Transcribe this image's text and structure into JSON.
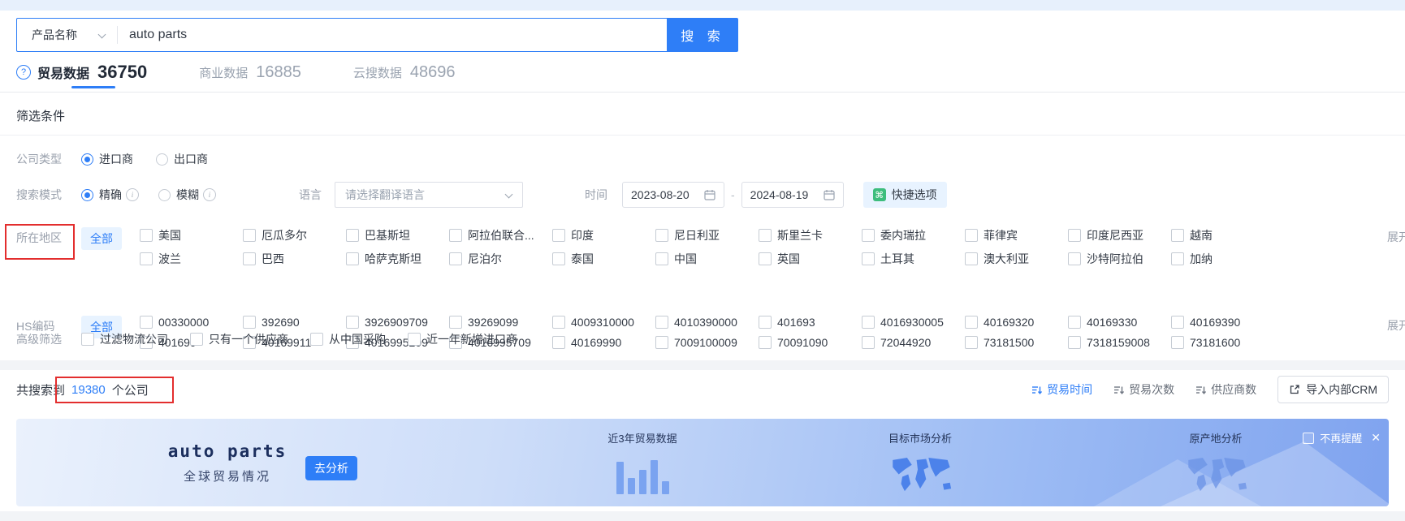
{
  "search": {
    "category": "产品名称",
    "query": "auto parts",
    "button": "搜 索"
  },
  "tabs": [
    {
      "label": "贸易数据",
      "count": "36750"
    },
    {
      "label": "商业数据",
      "count": "16885"
    },
    {
      "label": "云搜数据",
      "count": "48696"
    }
  ],
  "filter": {
    "title": "筛选条件",
    "company_type_label": "公司类型",
    "importer": "进口商",
    "exporter": "出口商",
    "search_mode_label": "搜索模式",
    "exact": "精确",
    "fuzzy": "模糊",
    "language_label": "语言",
    "language_placeholder": "请选择翻译语言",
    "time_label": "时间",
    "date_start": "2023-08-20",
    "date_end": "2024-08-19",
    "date_separator": "-",
    "quick_option": "快捷选项",
    "all": "全部",
    "expand": "展开",
    "region_label": "所在地区",
    "region_row1": [
      "美国",
      "厄瓜多尔",
      "巴基斯坦",
      "阿拉伯联合...",
      "印度",
      "尼日利亚",
      "斯里兰卡",
      "委内瑞拉",
      "菲律宾",
      "印度尼西亚",
      "越南"
    ],
    "region_row2": [
      "波兰",
      "巴西",
      "哈萨克斯坦",
      "尼泊尔",
      "泰国",
      "中国",
      "英国",
      "土耳其",
      "澳大利亚",
      "沙特阿拉伯",
      "加纳"
    ],
    "hs_label": "HS编码",
    "hs_row1": [
      "00330000",
      "392690",
      "3926909709",
      "39269099",
      "4009310000",
      "4010390000",
      "401693",
      "4016930005",
      "40169320",
      "40169330",
      "40169390"
    ],
    "hs_row2": [
      "401699",
      "40169911",
      "4016995209",
      "4016995709",
      "40169990",
      "7009100009",
      "70091090",
      "72044920",
      "73181500",
      "7318159008",
      "73181600"
    ],
    "advanced_label": "高级筛选",
    "advanced_options": [
      "过滤物流公司",
      "只有一个供应商",
      "从中国采购",
      "近一年新增进口商"
    ]
  },
  "results": {
    "prefix": "共搜索到",
    "count": "19380",
    "suffix": "个公司",
    "sort_trade_time": "贸易时间",
    "sort_trade_count": "贸易次数",
    "sort_supplier_count": "供应商数",
    "crm_button": "导入内部CRM"
  },
  "banner": {
    "title": "auto parts",
    "subtitle": "全球贸易情况",
    "analyze": "去分析",
    "feature1": "近3年贸易数据",
    "feature2": "目标市场分析",
    "feature3": "原产地分析",
    "dismiss": "不再提醒",
    "close": "✕",
    "bars": [
      40,
      20,
      30,
      42,
      16
    ]
  },
  "colors": {
    "primary": "#2e7ef7",
    "light_blue_bg": "#e8f3ff",
    "green_icon": "#3dbd7d",
    "annotation_red": "#e32e2e",
    "banner_gradient_start": "#eaf1fc",
    "banner_gradient_end": "#7fa3ef"
  }
}
